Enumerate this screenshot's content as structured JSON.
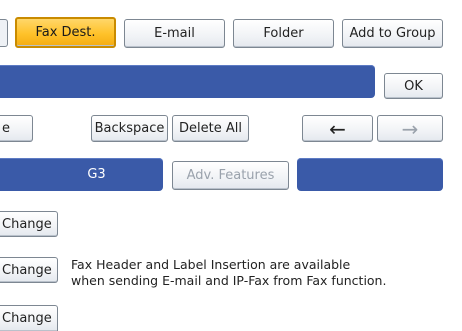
{
  "tabs": {
    "fax_dest": "Fax Dest.",
    "email": "E-mail",
    "folder": "Folder",
    "add_to_group": "Add to Group"
  },
  "header": {
    "ok_label": "OK"
  },
  "editing": {
    "clipped_left_label": "e",
    "backspace_label": "Backspace",
    "delete_all_label": "Delete All",
    "left_arrow": "←",
    "right_arrow": "→"
  },
  "fax_line": {
    "line_label": "G3",
    "adv_features_label": "Adv. Features"
  },
  "change_rows": [
    {
      "label": "Change"
    },
    {
      "label": "Change"
    },
    {
      "label": "Change"
    }
  ],
  "info_note": {
    "line1": "Fax Header and Label Insertion are available",
    "line2": "when sending E-mail and IP-Fax from Fax function."
  },
  "colors": {
    "accent_blue": "#3a5aa8",
    "active_tab": "#ffc22a",
    "disabled_text": "#9aa2ac"
  }
}
